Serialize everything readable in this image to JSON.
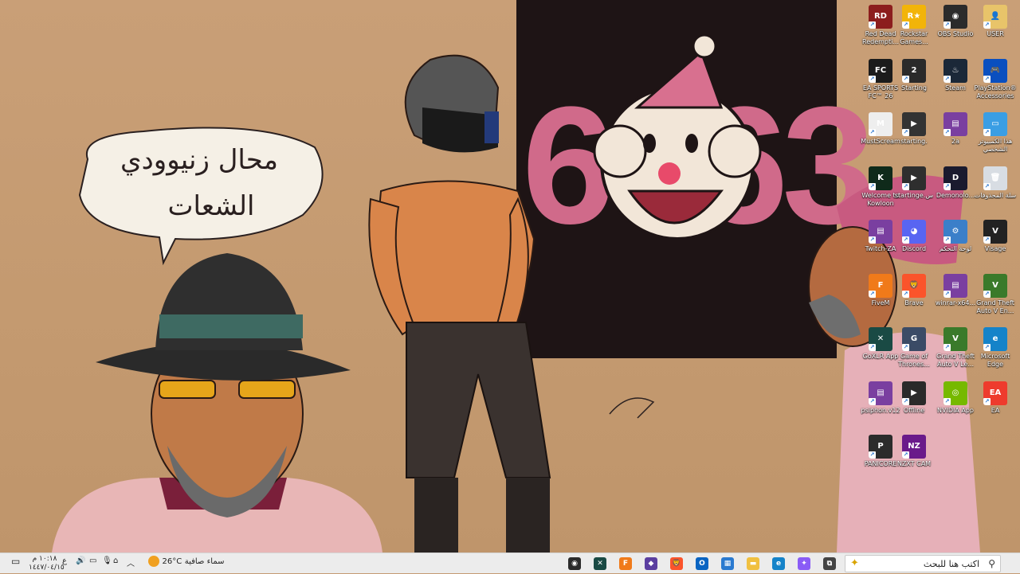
{
  "wallpaper": {
    "speech_bubble_line1": "محال زنيوودي",
    "speech_bubble_line2": "الشعات",
    "banner_number": "6363"
  },
  "desktop_icons": [
    {
      "label": "Red Dead Redempti...",
      "icon": "red-dead-icon",
      "color": "#8c1d1d",
      "glyph": "RD"
    },
    {
      "label": "Rockstar Games...",
      "icon": "rockstar-icon",
      "color": "#f2b409",
      "glyph": "R★"
    },
    {
      "label": "OBS Studio",
      "icon": "obs-icon",
      "color": "#2b2b2b",
      "glyph": "◉"
    },
    {
      "label": "USER",
      "icon": "user-folder-icon",
      "color": "#e8c46a",
      "glyph": "👤"
    },
    {
      "label": "EA SPORTS FC™ 26",
      "icon": "ea-fc-icon",
      "color": "#1b1b1b",
      "glyph": "FC"
    },
    {
      "label": "Starting",
      "icon": "starting-icon",
      "color": "#2a2a2a",
      "glyph": "2"
    },
    {
      "label": "Steam",
      "icon": "steam-icon",
      "color": "#1b2838",
      "glyph": "♨"
    },
    {
      "label": "PlayStation® Accessories",
      "icon": "playstation-icon",
      "color": "#0a4fbf",
      "glyph": "🎮"
    },
    {
      "label": "MustScream",
      "icon": "mustscream-icon",
      "color": "#eeeeee",
      "glyph": "M"
    },
    {
      "label": "starting.",
      "icon": "starting-video-icon",
      "color": "#333333",
      "glyph": "▶"
    },
    {
      "label": "2a",
      "icon": "winrar-archive-icon",
      "color": "#7a3fa0",
      "glyph": "▤"
    },
    {
      "label": "هذا الكمبيوتر الشخصي",
      "icon": "this-pc-icon",
      "color": "#3a9ee4",
      "glyph": "▭"
    },
    {
      "label": "Welcome to Kowloon",
      "icon": "kowloon-icon",
      "color": "#0f2a1a",
      "glyph": "K"
    },
    {
      "label": "startinge.س",
      "icon": "video-file-icon",
      "color": "#2e2e2e",
      "glyph": "▶"
    },
    {
      "label": "Demonolo...",
      "icon": "demonologist-icon",
      "color": "#1a1a2e",
      "glyph": "D"
    },
    {
      "label": "سلة المحذوفات",
      "icon": "recycle-bin-icon",
      "color": "#d8dde3",
      "glyph": "🗑"
    },
    {
      "label": "Twitch-ZA",
      "icon": "winrar-twitch-icon",
      "color": "#7a3fa0",
      "glyph": "▤"
    },
    {
      "label": "Discord",
      "icon": "discord-icon",
      "color": "#5865f2",
      "glyph": "◕"
    },
    {
      "label": "لوحة التحكم",
      "icon": "control-panel-icon",
      "color": "#3b7fc9",
      "glyph": "⚙"
    },
    {
      "label": "Visage",
      "icon": "visage-icon",
      "color": "#222222",
      "glyph": "V"
    },
    {
      "label": "FiveM",
      "icon": "fivem-icon",
      "color": "#f07a1a",
      "glyph": "F"
    },
    {
      "label": "Brave",
      "icon": "brave-icon",
      "color": "#fb542b",
      "glyph": "🦁"
    },
    {
      "label": "winrar-x64...",
      "icon": "winrar-installer-icon",
      "color": "#7a3fa0",
      "glyph": "▤"
    },
    {
      "label": "Grand Theft Auto V En...",
      "icon": "gta-v-icon",
      "color": "#3a7a2a",
      "glyph": "V"
    },
    {
      "label": "GoXLR App",
      "icon": "goxlr-icon",
      "color": "#1a4a44",
      "glyph": "✕"
    },
    {
      "label": "Game of Thrones...",
      "icon": "game-of-thrones-icon",
      "color": "#3b4b66",
      "glyph": "G"
    },
    {
      "label": "Grand Theft Auto V Le...",
      "icon": "gta-v-legacy-icon",
      "color": "#3a7a2a",
      "glyph": "V"
    },
    {
      "label": "Microsoft Edge",
      "icon": "edge-icon",
      "color": "#1583c9",
      "glyph": "e"
    },
    {
      "label": "psiphon.v12",
      "icon": "psiphon-icon",
      "color": "#7a3fa0",
      "glyph": "▤"
    },
    {
      "label": "Offline",
      "icon": "offline-icon",
      "color": "#2a2a2a",
      "glyph": "▶"
    },
    {
      "label": "NVIDIA App",
      "icon": "nvidia-icon",
      "color": "#76b900",
      "glyph": "◎"
    },
    {
      "label": "EA",
      "icon": "ea-app-icon",
      "color": "#ee3b2d",
      "glyph": "EA"
    },
    {
      "label": "PANICORE",
      "icon": "panicore-icon",
      "color": "#2b2b2b",
      "glyph": "P"
    },
    {
      "label": "NZXT CAM",
      "icon": "nzxt-cam-icon",
      "color": "#6a1a8a",
      "glyph": "NZ"
    }
  ],
  "taskbar": {
    "search_placeholder": "اكتب هنا للبحث",
    "apps": [
      {
        "name": "tb-task-view",
        "color": "#444444",
        "glyph": "⧉"
      },
      {
        "name": "tb-copilot",
        "color": "#8a5cf6",
        "glyph": "✦"
      },
      {
        "name": "tb-edge",
        "color": "#1583c9",
        "glyph": "e"
      },
      {
        "name": "tb-file-explorer",
        "color": "#f0c040",
        "glyph": "▬"
      },
      {
        "name": "tb-microsoft-store",
        "color": "#2a7ad0",
        "glyph": "▦"
      },
      {
        "name": "tb-outlook",
        "color": "#0a64c2",
        "glyph": "O"
      },
      {
        "name": "tb-brave",
        "color": "#fb542b",
        "glyph": "🦁"
      },
      {
        "name": "tb-app-purple",
        "color": "#5b3fa0",
        "glyph": "◆"
      },
      {
        "name": "tb-fivem",
        "color": "#f07a1a",
        "glyph": "F"
      },
      {
        "name": "tb-goxlr",
        "color": "#1a4a44",
        "glyph": "✕"
      },
      {
        "name": "tb-obs",
        "color": "#2b2b2b",
        "glyph": "◉"
      }
    ],
    "weather_text": "سماء صافية",
    "temperature": "26°C",
    "language": "ع",
    "time": "١٠:١٨ م",
    "date": "١٤٤٧/٠٤/١٥"
  }
}
